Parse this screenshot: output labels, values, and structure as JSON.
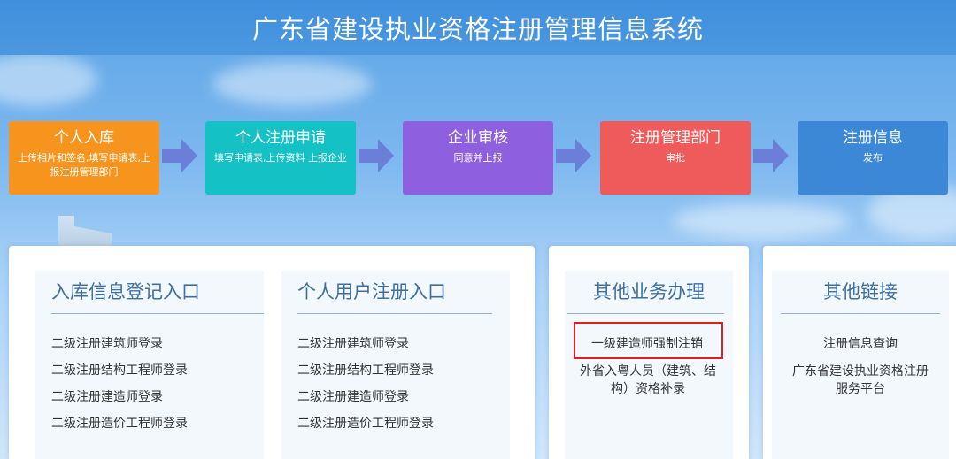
{
  "header": {
    "title": "广东省建设执业资格注册管理信息系统"
  },
  "colors": {
    "step1": "#f7941d",
    "step2": "#14c2c5",
    "step3": "#8e60e0",
    "step4": "#ef5a5a",
    "step5": "#3c87d6",
    "arrow": "#6c7fd8",
    "highlight": "#e02020"
  },
  "steps": [
    {
      "title": "个人入库",
      "desc": "上传相片和签名,填写申请表,上报注册管理部门"
    },
    {
      "title": "个人注册申请",
      "desc": "填写申请表,上传资料 上报企业"
    },
    {
      "title": "企业审核",
      "desc": "同意并上报"
    },
    {
      "title": "注册管理部门",
      "desc": "审批"
    },
    {
      "title": "注册信息",
      "desc": "发布"
    }
  ],
  "panels": {
    "entry": {
      "heading": "入库信息登记入口",
      "links": [
        "二级注册建筑师登录",
        "二级注册结构工程师登录",
        "二级注册建造师登录",
        "二级注册造价工程师登录"
      ]
    },
    "user": {
      "heading": "个人用户注册入口",
      "links": [
        "二级注册建筑师登录",
        "二级注册结构工程师登录",
        "二级注册建造师登录",
        "二级注册造价工程师登录"
      ]
    },
    "other_business": {
      "heading": "其他业务办理",
      "links": [
        "一级建造师强制注销",
        "外省入粤人员（建筑、结构）资格补录"
      ]
    },
    "other_links": {
      "heading": "其他链接",
      "links": [
        "注册信息查询",
        "广东省建设执业资格注册服务平台"
      ]
    }
  }
}
